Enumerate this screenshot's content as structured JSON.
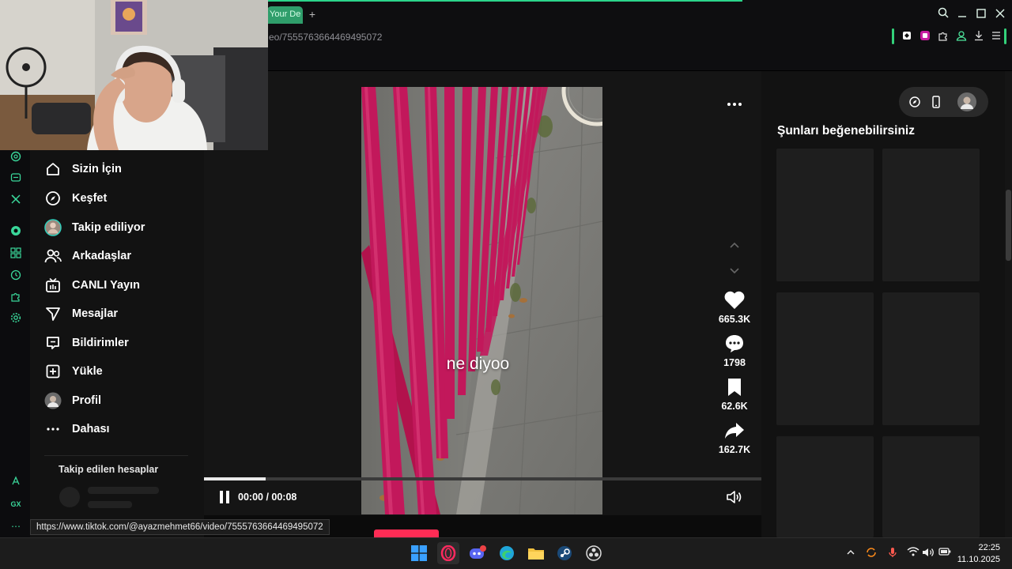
{
  "browser": {
    "active_tab_title": "Your De",
    "new_tab": "+",
    "url": "eo/7555763664469495072",
    "status_url": "https://www.tiktok.com/@ayazmehmet66/video/7555763664469495072"
  },
  "nav": {
    "items": [
      {
        "label": "Sizin İçin",
        "icon": "home-icon"
      },
      {
        "label": "Keşfet",
        "icon": "compass-icon"
      },
      {
        "label": "Takip ediliyor",
        "icon": "following-avatar-icon"
      },
      {
        "label": "Arkadaşlar",
        "icon": "friends-icon"
      },
      {
        "label": "CANLI Yayın",
        "icon": "live-icon"
      },
      {
        "label": "Mesajlar",
        "icon": "messages-icon"
      },
      {
        "label": "Bildirimler",
        "icon": "notifications-icon"
      },
      {
        "label": "Yükle",
        "icon": "upload-icon"
      },
      {
        "label": "Profil",
        "icon": "profile-avatar-icon"
      },
      {
        "label": "Dahası",
        "icon": "more-icon"
      }
    ],
    "following_heading": "Takip edilen hesaplar"
  },
  "video": {
    "caption": "ne diyoo",
    "time": "00:00 / 00:08",
    "progress_fraction": 0.11,
    "likes": "665.3K",
    "comments": "1798",
    "bookmarks": "62.6K",
    "shares": "162.7K"
  },
  "suggestions": {
    "title": "Şunları beğenebilirsiniz"
  },
  "taskbar": {
    "time": "22:25",
    "date": "11.10.2025"
  },
  "colors": {
    "opera_green": "#2bd48a",
    "tiktok_pink": "#fe2c55",
    "rail_magenta": "#c2185b"
  }
}
